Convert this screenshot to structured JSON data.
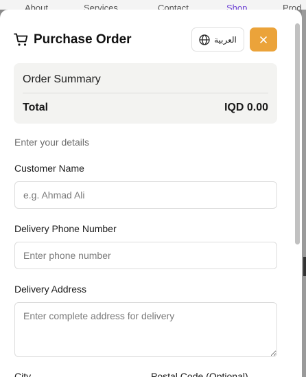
{
  "background_nav": [
    "About",
    "Services",
    "Contact",
    "Shop",
    "Prod"
  ],
  "modal": {
    "title": "Purchase Order",
    "language_button": "العربية",
    "close_icon": "close-icon",
    "accent_color": "#eba33a"
  },
  "summary": {
    "title": "Order Summary",
    "total_label": "Total",
    "total_value": "IQD 0.00"
  },
  "form": {
    "hint": "Enter your details",
    "customer_name": {
      "label": "Customer Name",
      "placeholder": "e.g. Ahmad Ali"
    },
    "phone": {
      "label": "Delivery Phone Number",
      "placeholder": "Enter phone number"
    },
    "address": {
      "label": "Delivery Address",
      "placeholder": "Enter complete address for delivery"
    },
    "city": {
      "label": "City"
    },
    "postal": {
      "label": "Postal Code (Optional)"
    }
  }
}
